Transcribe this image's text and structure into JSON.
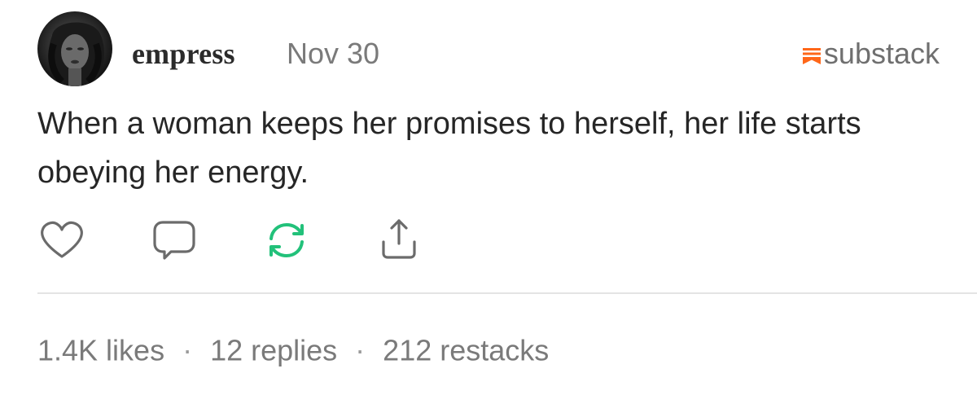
{
  "post": {
    "author": "empress",
    "date": "Nov 30",
    "brand": "substack",
    "body": "When a woman keeps her promises to herself, her life starts obeying her energy.",
    "stats": {
      "likes": "1.4K likes",
      "replies": "12 replies",
      "restacks": "212 restacks",
      "separator": "·"
    }
  },
  "icons": {
    "like": "heart-icon",
    "reply": "comment-icon",
    "restack": "restack-icon",
    "share": "share-icon",
    "brand": "substack-logo-icon"
  },
  "colors": {
    "brand_orange": "#ff6719",
    "restack_green": "#22c17a",
    "icon_gray": "#6b6b6b",
    "meta_gray": "#7a7a7a",
    "text": "#262626"
  }
}
